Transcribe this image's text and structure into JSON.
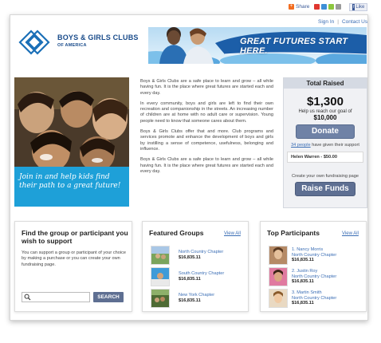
{
  "topbar": {
    "share_label": "Share",
    "like_label": "Like",
    "links": {
      "signin": "Sign In",
      "contact": "Contact Us"
    },
    "social_colors": [
      "#e0372f",
      "#3d8fd6",
      "#8cc63e",
      "#9a9a9a"
    ]
  },
  "banner": {
    "org_line1": "BOYS & GIRLS CLUBS",
    "org_line2": "OF AMERICA",
    "tagline": "GREAT FUTURES START HERE."
  },
  "hero": {
    "caption": "Join in and help kids find their path to a great future!"
  },
  "intro": {
    "paragraphs": [
      "Boys & Girls Clubs are a safe place to learn and grow – all while having fun. It is the place where great futures are started each and every day.",
      "In every community, boys and girls are left to find their own recreation and companionship in the streets. An increasing number of children are at home with no adult care or supervision. Young people need to know that someone cares about them.",
      "Boys & Girls Clubs offer that and more. Club programs and services promote and enhance the development of boys and girls by instilling a sense of competence, usefulness, belonging and influence.",
      "Boys & Girls Clubs are a safe place to learn and grow – all while having fun. It is the place where great futures are started each and every day."
    ]
  },
  "raised": {
    "title": "Total Raised",
    "amount": "$1,300",
    "goal_text": "Help us reach our goal of",
    "goal_amount": "$10,000",
    "donate_label": "Donate",
    "supporters_count": "34 people",
    "supporters_text": "have given their support",
    "recent_donor": "Helen Warren - $50.00",
    "create_text": "Create your own fundraising page",
    "raise_label": "Raise Funds"
  },
  "find": {
    "title": "Find the group or participant you wish to support",
    "description": "You can support a group or participant of your choice by making a purchase or you can create your own fundraising page.",
    "search_placeholder": "",
    "search_label": "SEARCH"
  },
  "groups": {
    "title": "Featured Groups",
    "view_all": "View All",
    "items": [
      {
        "name": "North Country Chapter",
        "amount": "$16,835.11"
      },
      {
        "name": "South Country Chapter",
        "amount": "$16,835.11"
      },
      {
        "name": "New York Chapter",
        "amount": "$16,835.11"
      }
    ]
  },
  "participants": {
    "title": "Top Participants",
    "view_all": "View All",
    "items": [
      {
        "rank_name": "1. Nancy Morris",
        "chapter": "North Country Chapter",
        "amount": "$16,835.11"
      },
      {
        "rank_name": "2. Justin Roy",
        "chapter": "North Country Chapter",
        "amount": "$16,835.11"
      },
      {
        "rank_name": "3. Martin Smith",
        "chapter": "North Country Chapter",
        "amount": "$16,835.11"
      }
    ]
  }
}
